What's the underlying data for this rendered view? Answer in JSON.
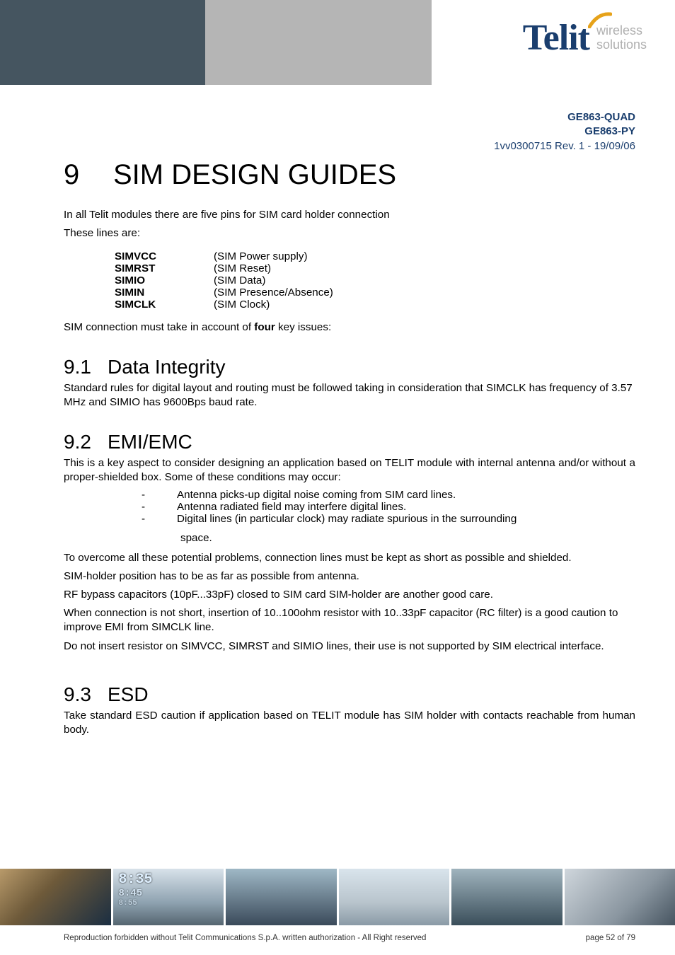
{
  "brand": {
    "name": "Telit",
    "tagline_line1": "wireless",
    "tagline_line2": "solutions"
  },
  "doc": {
    "model1": "GE863-QUAD",
    "model2": "GE863-PY",
    "rev": "1vv0300715 Rev. 1 - 19/09/06"
  },
  "section": {
    "num": "9",
    "title": "SIM DESIGN GUIDES"
  },
  "intro": {
    "line1": "In all Telit modules there are five pins for SIM card holder connection",
    "line2": "These lines are:"
  },
  "pins": [
    {
      "name": "SIMVCC",
      "desc": "(SIM Power supply)"
    },
    {
      "name": "SIMRST",
      "desc": "(SIM Reset)"
    },
    {
      "name": "SIMIO",
      "desc": "(SIM Data)"
    },
    {
      "name": "SIMIN",
      "desc": "(SIM Presence/Absence)"
    },
    {
      "name": "SIMCLK",
      "desc": "(SIM Clock)"
    }
  ],
  "issues_lead_pre": "SIM connection must take in account of ",
  "issues_lead_bold": "four",
  "issues_lead_post": " key issues:",
  "s91": {
    "num": "9.1",
    "title": "Data Integrity",
    "body": "Standard rules for digital layout and routing must be followed taking in consideration that SIMCLK has frequency of 3.57 MHz and SIMIO has 9600Bps baud rate."
  },
  "s92": {
    "num": "9.2",
    "title": "EMI/EMC",
    "lead": "This is a key aspect to consider designing an application based on TELIT module with internal antenna and/or without a proper-shielded box. Some of these conditions may occur:",
    "bullets": [
      "Antenna picks-up digital noise coming from SIM card lines.",
      "Antenna radiated field may interfere digital lines.",
      "Digital lines (in particular clock) may radiate spurious in the surrounding"
    ],
    "bullet3_cont": " space.",
    "after1": "To overcome all these potential problems, connection lines must be kept as short as possible and shielded.",
    "after2": "SIM-holder position has to be as far as possible from antenna.",
    "after3": "RF bypass capacitors (10pF...33pF) closed to SIM card SIM-holder are another good care.",
    "after4": "When connection is not short, insertion of 10..100ohm resistor with 10..33pF capacitor (RC filter) is a good caution to improve EMI from SIMCLK line.",
    "after5": "Do not insert resistor on SIMVCC, SIMRST and SIMIO lines, their use is not supported by SIM electrical interface."
  },
  "s93": {
    "num": "9.3",
    "title": "ESD",
    "body": "Take standard ESD caution if application based on TELIT module has SIM holder with contacts reachable from human body."
  },
  "strip_digits": {
    "big": "8:35",
    "mid": "8:45",
    "small": "8:55"
  },
  "footer": {
    "left": "Reproduction forbidden without Telit Communications S.p.A. written authorization - All Right reserved",
    "right": "page 52 of 79"
  }
}
